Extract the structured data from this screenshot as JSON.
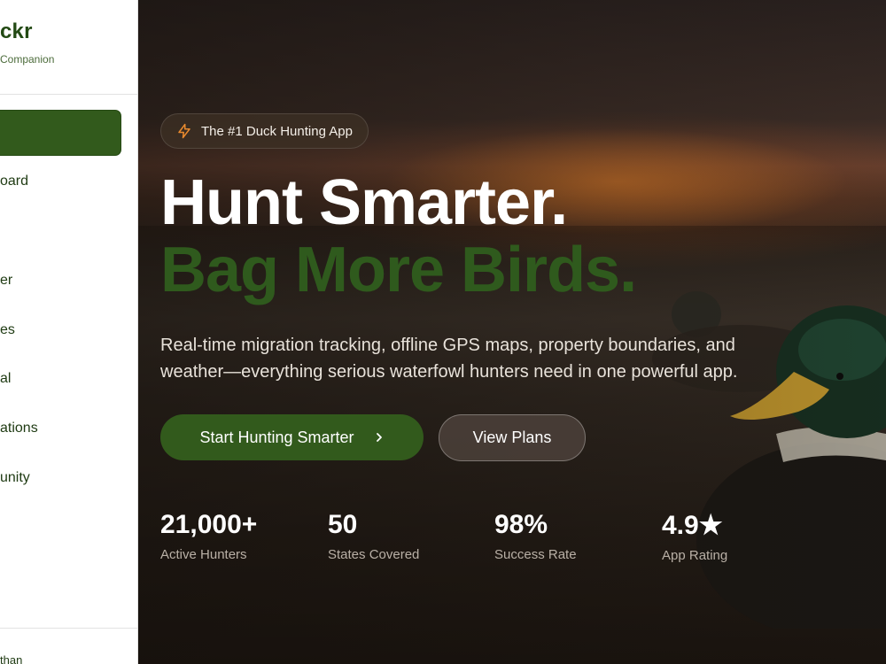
{
  "sidebar": {
    "brand_name": "ckr",
    "brand_tagline": "Companion",
    "items": [
      {
        "label": "oard"
      },
      {
        "label": "er"
      },
      {
        "label": "es"
      },
      {
        "label": "al"
      },
      {
        "label": "ations"
      },
      {
        "label": "unity"
      }
    ],
    "user_label": "than"
  },
  "hero": {
    "badge_icon": "lightning-icon",
    "badge_text": "The #1 Duck Hunting App",
    "headline_line1": "Hunt Smarter.",
    "headline_line2": "Bag More Birds.",
    "subtitle": "Real-time migration tracking, offline GPS maps, property boundaries, and weather—everything serious waterfowl hunters need in one powerful app.",
    "primary_button": "Start Hunting Smarter",
    "primary_button_icon": "chevron-right-icon",
    "secondary_button": "View Plans",
    "stats": [
      {
        "value": "21,000+",
        "label": "Active Hunters"
      },
      {
        "value": "50",
        "label": "States Covered"
      },
      {
        "value": "98%",
        "label": "Success Rate"
      },
      {
        "value": "4.9★",
        "label": "App Rating"
      }
    ]
  },
  "colors": {
    "brand_green": "#325a1c",
    "headline_green": "#2f5a1d",
    "badge_icon_orange": "#e8892e"
  }
}
